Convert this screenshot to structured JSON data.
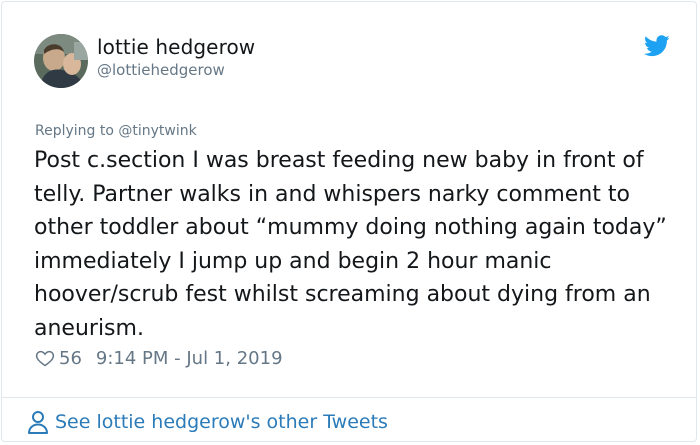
{
  "author": {
    "display_name": "lottie hedgerow",
    "handle": "@lottiehedgerow"
  },
  "reply": {
    "text": "Replying to @tinytwink"
  },
  "tweet": {
    "text": "Post c.section I was breast feeding new baby in front of telly. Partner walks in and whispers narky comment to other toddler about “mummy doing nothing again today” immediately I jump up and begin 2 hour manic hoover/scrub fest whilst screaming about dying from an aneurism.",
    "likes": "56",
    "timestamp": "9:14 PM - Jul 1, 2019"
  },
  "footer": {
    "link_text": "See lottie hedgerow's other Tweets"
  },
  "icons": {
    "brand": "twitter-bird-icon",
    "like": "heart-icon",
    "profile": "person-icon"
  },
  "colors": {
    "brand_blue": "#1da1f2",
    "link_blue": "#2b7bb9",
    "secondary_text": "#657786",
    "primary_text": "#14171a",
    "border": "#e1e8ed"
  }
}
